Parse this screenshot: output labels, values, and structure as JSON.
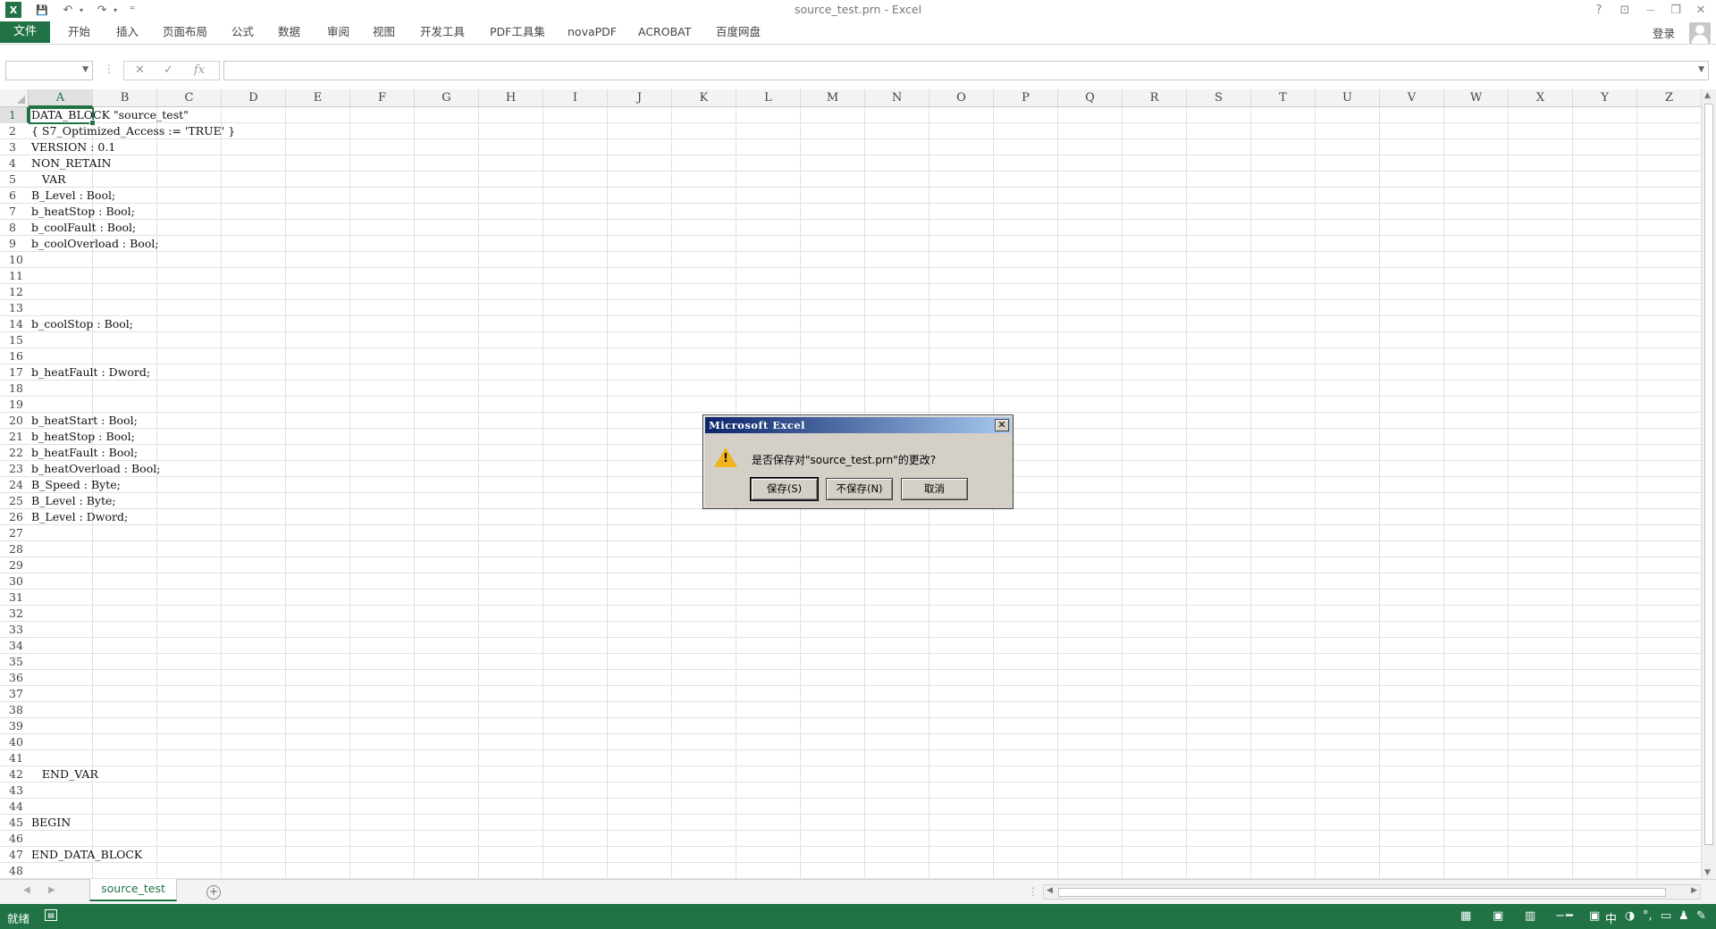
{
  "window": {
    "title": "source_test.prn - Excel",
    "help": "?",
    "ribbon_display": "⊡",
    "minimize": "—",
    "restore": "❐",
    "close": "✕"
  },
  "quick_access": {
    "save": "💾",
    "undo": "↶",
    "redo": "↷",
    "customize": "⁼"
  },
  "ribbon": {
    "file_tab": "文件",
    "tabs": [
      "开始",
      "插入",
      "页面布局",
      "公式",
      "数据",
      "审阅",
      "视图",
      "开发工具",
      "PDF工具集",
      "novaPDF",
      "ACROBAT",
      "百度网盘"
    ],
    "login": "登录"
  },
  "formula_bar": {
    "name_box_value": "",
    "cancel": "✕",
    "enter": "✓",
    "fx": "fx",
    "formula_value": ""
  },
  "grid": {
    "columns": [
      "A",
      "B",
      "C",
      "D",
      "E",
      "F",
      "G",
      "H",
      "I",
      "J",
      "K",
      "L",
      "M",
      "N",
      "O",
      "P",
      "Q",
      "R",
      "S",
      "T",
      "U",
      "V",
      "W",
      "X",
      "Y",
      "Z"
    ],
    "rows": [
      "1",
      "2",
      "3",
      "4",
      "5",
      "6",
      "7",
      "8",
      "9",
      "10",
      "11",
      "12",
      "13",
      "14",
      "15",
      "16",
      "17",
      "18",
      "19",
      "20",
      "21",
      "22",
      "23",
      "24",
      "25",
      "26",
      "27",
      "28",
      "29",
      "30",
      "31",
      "32",
      "33",
      "34",
      "35",
      "36",
      "37",
      "38",
      "39",
      "40",
      "41",
      "42",
      "43",
      "44",
      "45",
      "46",
      "47",
      "48"
    ],
    "selected_cell": "A1",
    "cells": [
      {
        "row": 1,
        "text": "DATA_BLOCK \"source_test\""
      },
      {
        "row": 2,
        "text": "{ S7_Optimized_Access := 'TRUE' }"
      },
      {
        "row": 3,
        "text": "VERSION : 0.1"
      },
      {
        "row": 4,
        "text": "NON_RETAIN"
      },
      {
        "row": 5,
        "text": "   VAR"
      },
      {
        "row": 6,
        "text": "B_Level : Bool;"
      },
      {
        "row": 7,
        "text": "b_heatStop : Bool;"
      },
      {
        "row": 8,
        "text": "b_coolFault : Bool;"
      },
      {
        "row": 9,
        "text": "b_coolOverload : Bool;"
      },
      {
        "row": 14,
        "text": "b_coolStop : Bool;"
      },
      {
        "row": 17,
        "text": "b_heatFault : Dword;"
      },
      {
        "row": 20,
        "text": "b_heatStart : Bool;"
      },
      {
        "row": 21,
        "text": "b_heatStop : Bool;"
      },
      {
        "row": 22,
        "text": "b_heatFault : Bool;"
      },
      {
        "row": 23,
        "text": "b_heatOverload : Bool;"
      },
      {
        "row": 24,
        "text": "B_Speed : Byte;"
      },
      {
        "row": 25,
        "text": "B_Level : Byte;"
      },
      {
        "row": 26,
        "text": "B_Level : Dword;"
      },
      {
        "row": 42,
        "text": "   END_VAR"
      },
      {
        "row": 45,
        "text": "BEGIN"
      },
      {
        "row": 47,
        "text": "END_DATA_BLOCK"
      }
    ]
  },
  "sheets": {
    "active": "source_test",
    "add": "+"
  },
  "status": {
    "text": "就绪",
    "ime": "中"
  },
  "dialog": {
    "title": "Microsoft Excel",
    "message": "是否保存对\"source_test.prn\"的更改?",
    "warning_mark": "!",
    "buttons": {
      "save": "保存(S)",
      "dont_save": "不保存(N)",
      "cancel": "取消"
    },
    "close": "✕"
  },
  "colors": {
    "accent": "#217346",
    "dialog_title_start": "#0a246a",
    "dialog_title_end": "#a6caf0"
  }
}
